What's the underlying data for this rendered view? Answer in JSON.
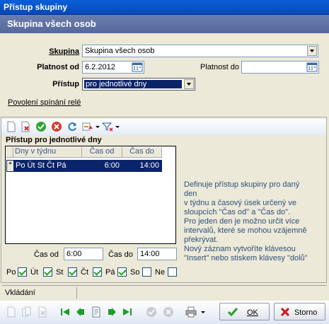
{
  "window": {
    "title": "Přístup skupiny"
  },
  "header": {
    "title": "Skupina všech osob"
  },
  "form": {
    "skupina_label": "Skupina",
    "skupina_value": "Skupina všech osob",
    "platnost_od_label": "Platnost od",
    "platnost_od_value": "6.2.2012",
    "platnost_do_label": "Platnost do",
    "platnost_do_value": "",
    "pristup_label": "Přístup",
    "pristup_value": "pro jednotlivé dny"
  },
  "link": {
    "relay_permission": "Povolení spínání relé"
  },
  "section": {
    "title": "Přístup pro jednotlivé dny"
  },
  "grid": {
    "columns": [
      "Dny v týdnu",
      "Čas od",
      "Čas do"
    ],
    "rows": [
      {
        "marker": "*",
        "days": "Po Út St Čt Pá",
        "from": "6:00",
        "to": "14:00"
      }
    ]
  },
  "description": {
    "lines": [
      "Definuje přístup skupiny pro daný",
      "den",
      "v týdnu a časový úsek určený ve",
      "sloupcích \"Čas od\" a \"Čas do\".",
      "Pro jeden den je možno určit více",
      "intervalů, které se mohou vzájemně",
      "překrývat.",
      "Nový záznam vytvoříte klávesou",
      "\"Insert\" nebo stiskem klávesy \"dolů\""
    ]
  },
  "time": {
    "from_label": "Čas od",
    "from_value": "6:00",
    "to_label": "Čas do",
    "to_value": "14:00"
  },
  "days": [
    {
      "label": "Po",
      "checked": true
    },
    {
      "label": "Út",
      "checked": true
    },
    {
      "label": "St",
      "checked": true
    },
    {
      "label": "Čt",
      "checked": true
    },
    {
      "label": "Pá",
      "checked": true
    },
    {
      "label": "So",
      "checked": false
    },
    {
      "label": "Ne",
      "checked": false
    }
  ],
  "status": {
    "text": "Vkládání"
  },
  "buttons": {
    "ok": "OK",
    "storno": "Storno"
  },
  "colors": {
    "title_bar": "#0848b8",
    "header": "#5d6fa2",
    "selection": "#0a246a",
    "accent_text": "#2c4f7c"
  }
}
